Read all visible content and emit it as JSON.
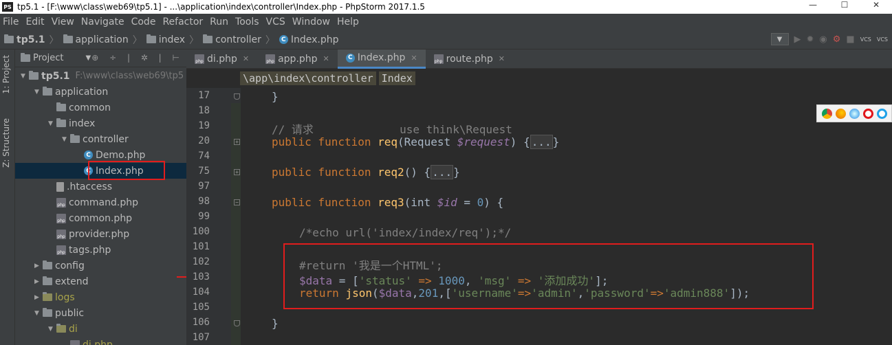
{
  "window": {
    "title": "tp5.1 - [F:\\www\\class\\web69\\tp5.1] - ...\\application\\index\\controller\\Index.php - PhpStorm 2017.1.5",
    "logo": "PS",
    "minimize": "—",
    "maximize": "☐",
    "close": "✕"
  },
  "menu": [
    "File",
    "Edit",
    "View",
    "Navigate",
    "Code",
    "Refactor",
    "Run",
    "Tools",
    "VCS",
    "Window",
    "Help"
  ],
  "breadcrumb": [
    "tp5.1",
    "application",
    "index",
    "controller",
    "Index.php"
  ],
  "toolbar": {
    "vcs1": "VCS",
    "vcs2": "VCS"
  },
  "side_tabs": {
    "project": "1: Project",
    "structure": "Z: Structure"
  },
  "project_panel": {
    "title": "Project",
    "icons": "⊕ ÷ | ✲ | ⊢"
  },
  "tree": [
    {
      "label": "tp5.1",
      "path": "F:\\www\\class\\web69\\tp5",
      "icon": "folder",
      "depth": 0,
      "arrow": "▼",
      "bold": true
    },
    {
      "label": "application",
      "icon": "folder",
      "depth": 1,
      "arrow": "▼"
    },
    {
      "label": "common",
      "icon": "folder",
      "depth": 2,
      "arrow": ""
    },
    {
      "label": "index",
      "icon": "folder",
      "depth": 2,
      "arrow": "▼"
    },
    {
      "label": "controller",
      "icon": "folder",
      "depth": 3,
      "arrow": "▼"
    },
    {
      "label": "Demo.php",
      "icon": "class",
      "depth": 4,
      "arrow": ""
    },
    {
      "label": "Index.php",
      "icon": "class",
      "depth": 4,
      "arrow": "",
      "selected": true
    },
    {
      "label": ".htaccess",
      "icon": "file",
      "depth": 2,
      "arrow": ""
    },
    {
      "label": "command.php",
      "icon": "php",
      "depth": 2,
      "arrow": ""
    },
    {
      "label": "common.php",
      "icon": "php",
      "depth": 2,
      "arrow": ""
    },
    {
      "label": "provider.php",
      "icon": "php",
      "depth": 2,
      "arrow": ""
    },
    {
      "label": "tags.php",
      "icon": "php",
      "depth": 2,
      "arrow": ""
    },
    {
      "label": "config",
      "icon": "folder",
      "depth": 1,
      "arrow": "▶"
    },
    {
      "label": "extend",
      "icon": "folder",
      "depth": 1,
      "arrow": "▶"
    },
    {
      "label": "logs",
      "icon": "folder",
      "depth": 1,
      "arrow": "▶",
      "muted": true
    },
    {
      "label": "public",
      "icon": "folder",
      "depth": 1,
      "arrow": "▼"
    },
    {
      "label": "di",
      "icon": "folder",
      "depth": 2,
      "arrow": "▼",
      "muted": true
    },
    {
      "label": "di.php",
      "icon": "php",
      "depth": 3,
      "arrow": "",
      "muted": true
    }
  ],
  "tabs": [
    {
      "label": "di.php",
      "icon": "php",
      "active": false
    },
    {
      "label": "app.php",
      "icon": "php",
      "active": false
    },
    {
      "label": "Index.php",
      "icon": "class",
      "active": true
    },
    {
      "label": "route.php",
      "icon": "php",
      "active": false
    }
  ],
  "context": [
    "\\app\\index\\controller",
    "Index"
  ],
  "lines": [
    {
      "n": "17",
      "fold": "end"
    },
    {
      "n": "18",
      "fold": ""
    },
    {
      "n": "19",
      "fold": ""
    },
    {
      "n": "20",
      "fold": "plus"
    },
    {
      "n": "74",
      "fold": ""
    },
    {
      "n": "75",
      "fold": "plus"
    },
    {
      "n": "97",
      "fold": ""
    },
    {
      "n": "98",
      "fold": "minus"
    },
    {
      "n": "99",
      "fold": ""
    },
    {
      "n": "100",
      "fold": ""
    },
    {
      "n": "101",
      "fold": ""
    },
    {
      "n": "102",
      "fold": ""
    },
    {
      "n": "103",
      "fold": ""
    },
    {
      "n": "104",
      "fold": ""
    },
    {
      "n": "105",
      "fold": ""
    },
    {
      "n": "106",
      "fold": "end"
    },
    {
      "n": "107",
      "fold": ""
    }
  ],
  "code": {
    "l17": "}",
    "l19": "// 请求             use think\\Request",
    "l20_kw": "public function ",
    "l20_fn": "req",
    "l20_a": "(Request ",
    "l20_var": "$request",
    "l20_b": ") {",
    "l20_dots": "...",
    "l20_c": "}",
    "l75_kw": "public function ",
    "l75_fn": "req2",
    "l75_a": "() {",
    "l75_dots": "...",
    "l75_c": "}",
    "l98_kw": "public function ",
    "l98_fn": "req3",
    "l98_a": "(int ",
    "l98_var": "$id",
    "l98_b": " = ",
    "l98_num": "0",
    "l98_c": ") {",
    "l100": "/*echo url('index/index/req');*/",
    "l102": "#return '我是一个HTML';",
    "l103_var": "$data",
    "l103_a": " = [",
    "l103_s1": "'status'",
    "l103_op1": " => ",
    "l103_num": "1000",
    "l103_b": ", ",
    "l103_s2": "'msg'",
    "l103_op2": " => ",
    "l103_s3": "'添加成功'",
    "l103_c": "];",
    "l104_kw": "return ",
    "l104_fn": "json",
    "l104_a": "(",
    "l104_var": "$data",
    "l104_b": ",",
    "l104_num": "201",
    "l104_c": ",[",
    "l104_s1": "'username'",
    "l104_op1": "=>",
    "l104_s2": "'admin'",
    "l104_d": ",",
    "l104_s3": "'password'",
    "l104_op2": "=>",
    "l104_s4": "'admin888'",
    "l104_e": "]);",
    "l106": "}"
  },
  "browser_icons": [
    "chrome-icon",
    "firefox-icon",
    "safari-icon",
    "opera-icon",
    "ie-icon"
  ],
  "colors": {
    "keyword": "#cc7832",
    "function": "#ffc66d",
    "variable": "#9876aa",
    "string": "#6a8759",
    "number": "#6897bb",
    "comment": "#808080",
    "highlight": "#e11d1d"
  }
}
